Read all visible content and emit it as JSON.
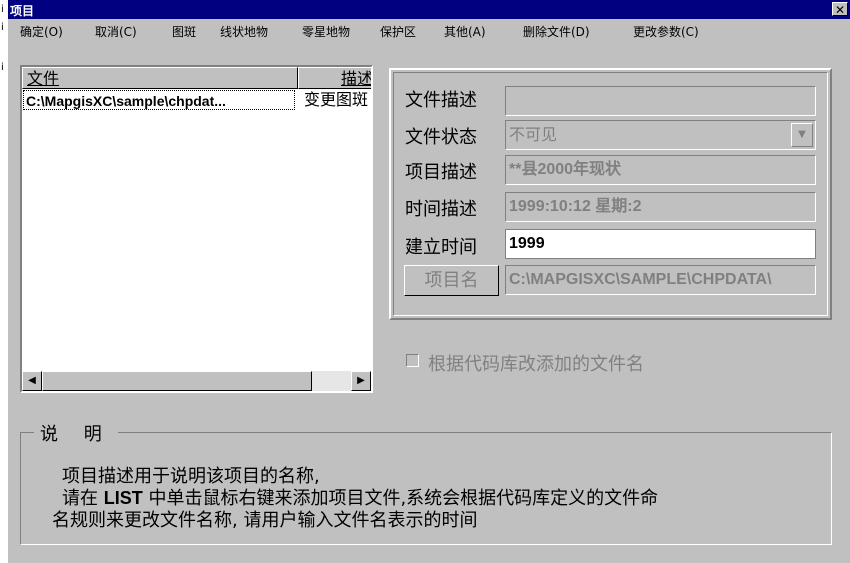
{
  "window": {
    "title": "项目",
    "close_label": "✕"
  },
  "menu": [
    {
      "label": "确定(O)"
    },
    {
      "label": "取消(C)"
    },
    {
      "label": "图斑"
    },
    {
      "label": "线状地物"
    },
    {
      "label": "零星地物"
    },
    {
      "label": "保护区"
    },
    {
      "label": "其他(A)"
    },
    {
      "label": "删除文件(D)"
    },
    {
      "label": "更改参数(C)"
    }
  ],
  "file_list": {
    "columns": [
      "文件",
      "描述"
    ],
    "rows": [
      {
        "file": "C:\\MapgisXC\\sample\\chpdat...",
        "desc": "变更图斑"
      }
    ]
  },
  "fields": {
    "file_desc": {
      "label": "文件描述",
      "value": ""
    },
    "file_status": {
      "label": "文件状态",
      "value": "不可见"
    },
    "project_desc": {
      "label": "项目描述",
      "value": "**县2000年现状"
    },
    "time_desc": {
      "label": "时间描述",
      "value": "1999:10:12 星期:2"
    },
    "created_time": {
      "label": "建立时间",
      "value": "1999"
    },
    "project_name": {
      "label": "项目名",
      "value": "C:\\MAPGISXC\\SAMPLE\\CHPDATA\\"
    }
  },
  "checkbox": {
    "label": "根据代码库改添加的文件名",
    "checked": false
  },
  "description": {
    "legend": "说 明",
    "line1": "项目描述用于说明该项目的名称,",
    "line2_pre": "请在 ",
    "line2_bold": "LIST",
    "line2_post": " 中单击鼠标右键来添加项目文件,系统会根据代码库定义的文件命",
    "line3": "名规则来更改文件名称, 请用户输入文件名表示的时间"
  },
  "icons": {
    "dropdown": "chevron-down-icon",
    "scroll_left": "arrow-left-icon",
    "scroll_right": "arrow-right-icon",
    "close": "close-icon"
  }
}
